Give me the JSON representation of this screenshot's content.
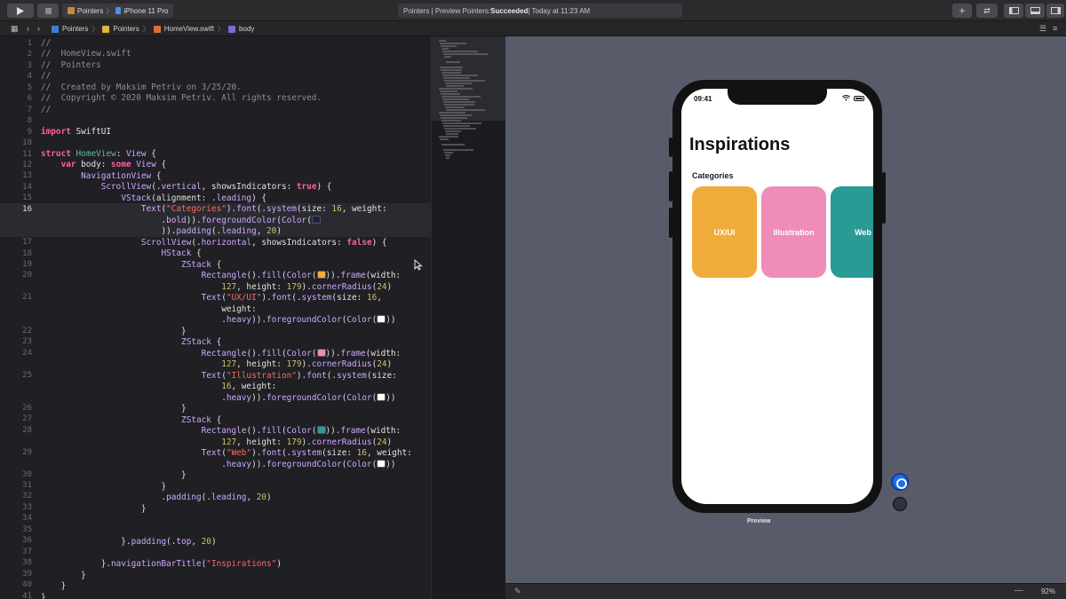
{
  "toolbar": {
    "scheme": "Pointers",
    "device": "iPhone 11 Pro",
    "status_prefix": "Pointers | Preview Pointers: ",
    "status_result": "Succeeded",
    "status_time": " | Today at 11:23 AM"
  },
  "jumpbar": {
    "crumbs": [
      "Pointers",
      "Pointers",
      "HomeView.swift",
      "body"
    ]
  },
  "editor": {
    "line_numbers": [
      "1",
      "2",
      "3",
      "4",
      "5",
      "6",
      "7",
      "8",
      "9",
      "10",
      "11",
      "12",
      "13",
      "14",
      "15",
      "16",
      "",
      "",
      "17",
      "18",
      "19",
      "20",
      "",
      "21",
      "",
      "",
      "22",
      "23",
      "24",
      "",
      "25",
      "",
      "",
      "26",
      "27",
      "28",
      "",
      "29",
      "",
      "30",
      "31",
      "32",
      "33",
      "34",
      "35",
      "36",
      "37",
      "38",
      "39",
      "40",
      "41"
    ]
  },
  "phone": {
    "time": "09:41",
    "nav_title": "Inspirations",
    "section_label": "Categories",
    "cards": [
      {
        "label": "UX/UI",
        "color": "#f0ac3a"
      },
      {
        "label": "Illustration",
        "color": "#ef8cb8"
      },
      {
        "label": "Web",
        "color": "#2a9a94"
      }
    ]
  },
  "canvas": {
    "preview_label": "Preview",
    "zoom": "92%"
  },
  "colors": {
    "accent_blue": "#1e6df0",
    "editor_bg": "#1f1f24",
    "canvas_bg": "#585c6a"
  }
}
